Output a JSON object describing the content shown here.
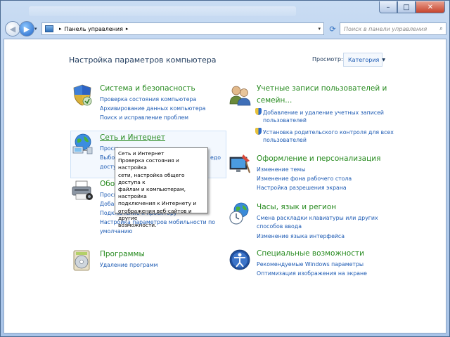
{
  "window": {
    "minimize_glyph": "–",
    "maximize_glyph": "□",
    "close_glyph": "✕"
  },
  "nav": {
    "back_glyph": "◀",
    "forward_glyph": "▶",
    "history_glyph": "▾",
    "breadcrumb": "Панель управления",
    "separator_glyph": "▸",
    "refresh_glyph": "⟳",
    "search_placeholder": "Поиск в панели управления",
    "search_glyph": "⌕"
  },
  "header": {
    "title": "Настройка параметров компьютера",
    "view_label": "Просмотр:",
    "view_value": "Категория"
  },
  "categories": {
    "system": {
      "icon": "security-shield-icon",
      "title": "Система и безопасность",
      "links": [
        "Проверка состояния компьютера",
        "Архивирование данных компьютера",
        "Поиск и исправление проблем"
      ]
    },
    "network": {
      "icon": "network-globe-icon",
      "title": "Сеть и Интернет",
      "links": [
        "Просм",
        "Выбор",
        "досту"
      ],
      "links_right": [
        "едо"
      ]
    },
    "hardware": {
      "icon": "printer-icon",
      "title_partial": "Обор",
      "links": [
        "Просм",
        "Добав",
        "Подключение к проектору",
        "Настройка параметров мобильности по",
        "умолчанию"
      ]
    },
    "programs": {
      "icon": "programs-disc-icon",
      "title": "Программы",
      "links": [
        "Удаление программ"
      ]
    },
    "users": {
      "icon": "users-icon",
      "title_line1": "Учетные записи пользователей и",
      "title_line2": "семейн...",
      "links": [
        "Добавление и удаление учетных записей",
        "пользователей",
        "Установка родительского контроля для всех",
        "пользователей"
      ]
    },
    "appearance": {
      "icon": "appearance-monitor-icon",
      "title": "Оформление и персонализация",
      "links": [
        "Изменение темы",
        "Изменение фона рабочего стола",
        "Настройка разрешения экрана"
      ]
    },
    "clock": {
      "icon": "clock-globe-icon",
      "title": "Часы, язык и регион",
      "links": [
        "Смена раскладки клавиатуры или других",
        "способов ввода",
        "Изменение языка интерфейса"
      ]
    },
    "access": {
      "icon": "accessibility-icon",
      "title": "Специальные возможности",
      "links": [
        "Рекомендуемые Windows параметры",
        "Оптимизация изображения на экране"
      ]
    }
  },
  "tooltip": {
    "title": "Сеть и Интернет",
    "lines": [
      "Проверка состояния и настройка",
      "сети, настройка общего доступа к",
      "файлам и компьютерам, настройка",
      "подключения к Интернету и",
      "отображения веб-сайтов и другие",
      "возможности."
    ]
  }
}
